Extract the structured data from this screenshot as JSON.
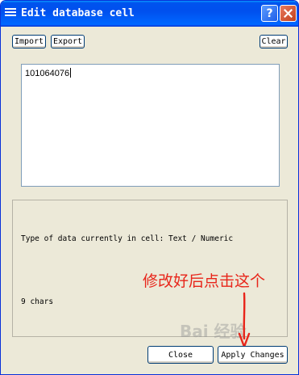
{
  "window": {
    "title": "Edit database cell"
  },
  "titlebar": {
    "help_label": "?",
    "icons": [
      "system-menu-icon",
      "help-icon",
      "close-icon"
    ]
  },
  "toolbar": {
    "import_label": "Import",
    "export_label": "Export",
    "clear_label": "Clear"
  },
  "editor": {
    "value": "101064076"
  },
  "info": {
    "type_text": "Type of data currently in cell: Text / Numeric",
    "chars_text": "9 chars"
  },
  "annotation": {
    "text": "修改好后点击这个",
    "color": "#e8251a"
  },
  "watermark": {
    "text": "Bai 经验"
  },
  "footer": {
    "close_label": "Close",
    "apply_label": "Apply Changes"
  }
}
